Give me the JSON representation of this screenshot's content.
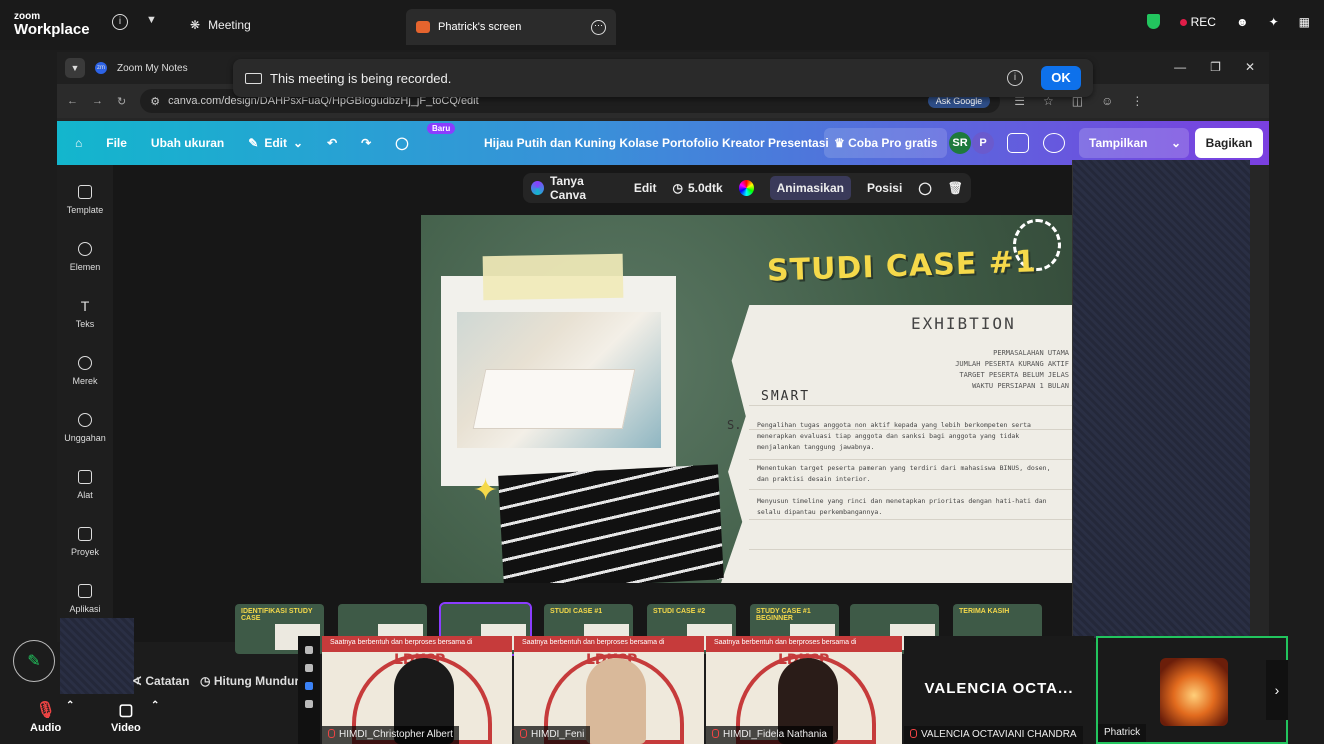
{
  "zoom": {
    "logo_small": "zoom",
    "logo_big": "Workplace",
    "meeting_label": "Meeting",
    "screen_tab": "Phatrick's screen",
    "rec_label": "REC",
    "banner_text": "This meeting is being recorded.",
    "banner_ok": "OK",
    "audio_label": "Audio",
    "video_label": "Video"
  },
  "browser": {
    "tab_title": "Zoom My Notes",
    "url": "canva.com/design/DAHPsxFuaQ/HpGBlogudbzHj_jF_toCQ/edit",
    "ask_google": "Ask Google"
  },
  "canva": {
    "menu": [
      "File",
      "Ubah ukuran",
      "Edit"
    ],
    "new_badge": "Baru",
    "doc_title": "Hijau Putih dan Kuning Kolase Portofolio Kreator Presentasi",
    "pro_button": "Coba Pro gratis",
    "avatars": [
      "SR",
      "P"
    ],
    "show_button": "Tampilkan",
    "share_button": "Bagikan",
    "sidebar": [
      "Template",
      "Elemen",
      "Teks",
      "Merek",
      "Unggahan",
      "Alat",
      "Proyek",
      "Aplikasi"
    ],
    "float_toolbar": {
      "ask": "Tanya Canva",
      "edit": "Edit",
      "duration": "5.0dtk",
      "animate": "Animasikan",
      "position": "Posisi"
    },
    "notes": "Catatan",
    "timer": "Hitung Mundur",
    "thumbs": [
      "IDENTIFIKASI STUDY CASE",
      "",
      "",
      "STUDI CASE #1",
      "STUDI CASE #2",
      "STUDY CASE #1 BEGINNER",
      "",
      "TERIMA KASIH"
    ]
  },
  "slide": {
    "heading": "STUDI CASE #1",
    "subheading": "EXHIBTION",
    "problem_title": "PERMASALAHAN UTAMA",
    "problems": [
      "JUMLAH PESERTA KURANG AKTIF",
      "TARGET PESERTA BELUM JELAS",
      "WAKTU PERSIAPAN 1 BULAN"
    ],
    "smart_label": "SMART",
    "s_letter": "S.",
    "paragraphs": [
      "Pengalihan tugas anggota non aktif kepada yang lebih berkompeten serta menerapkan evaluasi tiap anggota dan sanksi bagi anggota yang tidak menjalankan tanggung jawabnya.",
      "Menentukan target peserta pameran yang terdiri dari mahasiswa BINUS, dosen, dan praktisi desain interior.",
      "Menyusun timeline yang rinci dan menetapkan prioritas dengan hati-hati dan selalu dipantau perkembangannya."
    ]
  },
  "participants": [
    {
      "name": "HIMDI_Christopher Albert",
      "banner": "Saatnya berbentuh dan berproses bersama di",
      "logo": "LDKCP"
    },
    {
      "name": "HIMDI_Feni",
      "banner": "Saatnya berbentuh dan berproses bersama di",
      "logo": "LDKCP"
    },
    {
      "name": "HIMDI_Fidela Nathania",
      "banner": "Saatnya berbentuh dan berproses bersama di",
      "logo": "LDKCP"
    },
    {
      "name": "VALENCIA OCTAVIANI CHANDRA",
      "big": "VALENCIA  OCTA..."
    },
    {
      "name": "Phatrick"
    }
  ]
}
